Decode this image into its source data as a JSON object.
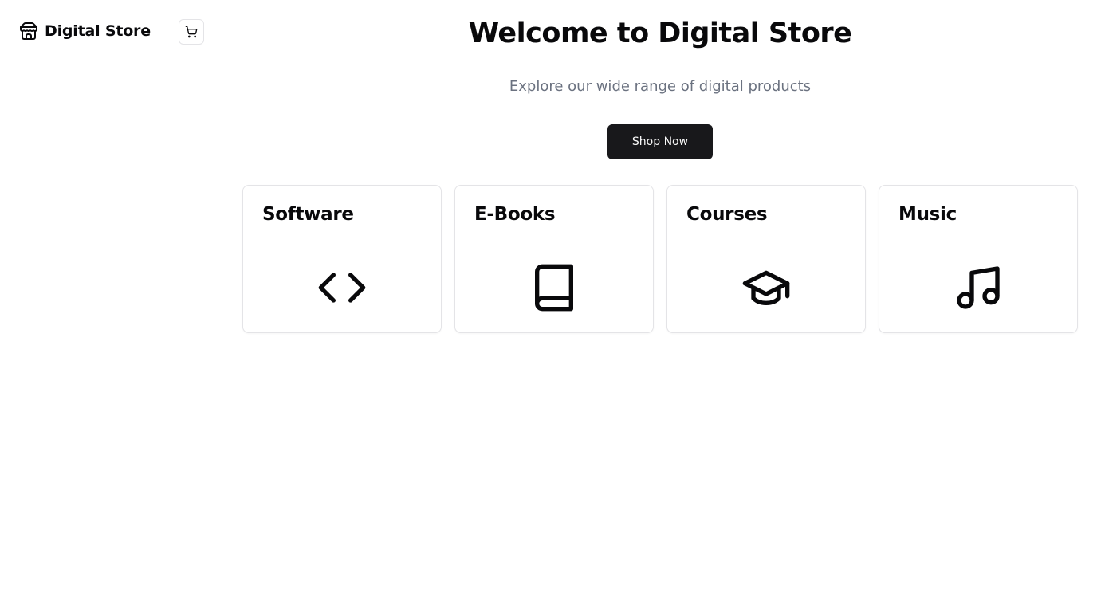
{
  "sidebar": {
    "brand": {
      "name": "Digital Store",
      "icon": "store-icon"
    },
    "cart": {
      "icon": "shopping-cart-icon"
    }
  },
  "hero": {
    "title": "Welcome to Digital Store",
    "subtitle": "Explore our wide range of digital products",
    "cta_label": "Shop Now"
  },
  "categories": [
    {
      "title": "Software",
      "icon": "code-icon"
    },
    {
      "title": "E-Books",
      "icon": "book-icon"
    },
    {
      "title": "Courses",
      "icon": "graduation-cap-icon"
    },
    {
      "title": "Music",
      "icon": "music-icon"
    }
  ],
  "colors": {
    "text": "#09090b",
    "muted": "#6b7280",
    "primary_button": "#18181b",
    "border": "#e4e4e7"
  }
}
